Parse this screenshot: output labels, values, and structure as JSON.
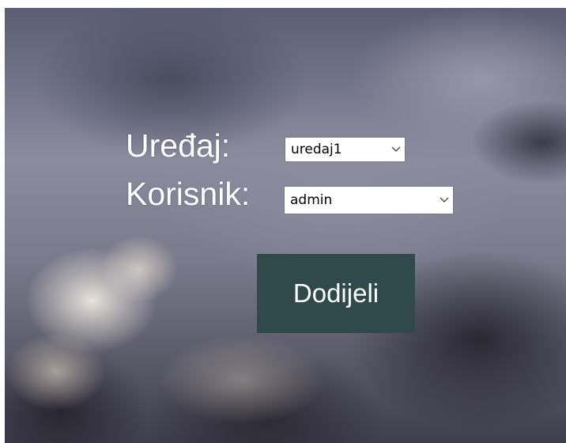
{
  "form": {
    "device_label": "Uređaj:",
    "device_value": "uredaj1",
    "user_label": "Korisnik:",
    "user_value": "admin",
    "assign_button": "Dodijeli"
  },
  "colors": {
    "button_bg": "#304a4c",
    "text": "#ffffff"
  },
  "icons": {
    "dropdown": "chevron-down-icon"
  }
}
